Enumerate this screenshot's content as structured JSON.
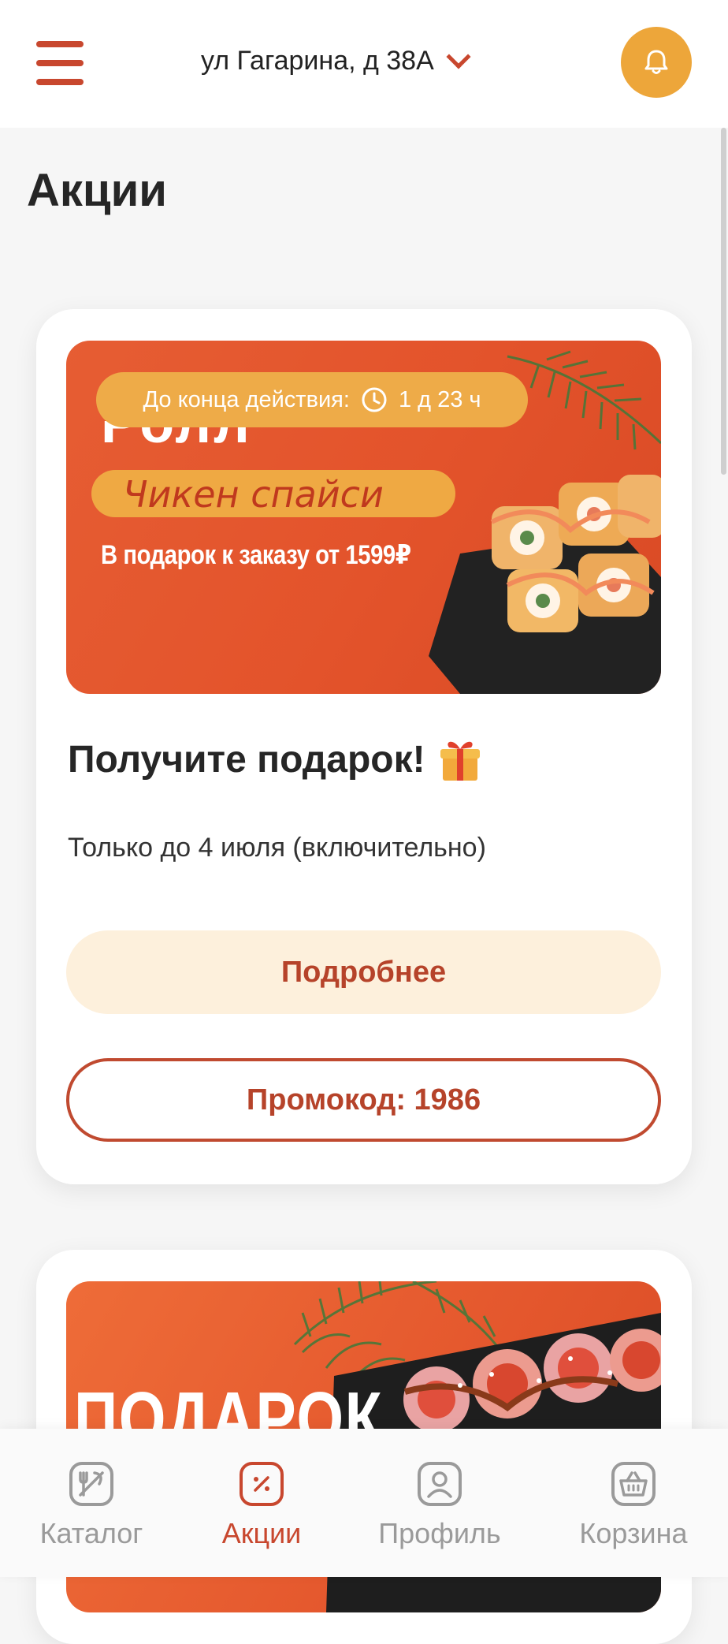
{
  "header": {
    "address": "ул Гагарина, д 38А"
  },
  "page": {
    "title": "Акции"
  },
  "promos": [
    {
      "timer_label": "До конца действия:",
      "timer_value": "1 д 23 ч",
      "banner_title": "Ролл",
      "banner_product": "Чикен спайси",
      "banner_subtitle": "В подарок к заказу от 1599₽",
      "title": "Получите подарок!",
      "subtitle": "Только до 4 июля (включительно)",
      "more_label": "Подробнее",
      "promo_label": "Промокод: 1986"
    },
    {
      "banner_title": "ПОДАРОК"
    }
  ],
  "nav": {
    "items": [
      {
        "label": "Каталог",
        "icon": "catalog-icon"
      },
      {
        "label": "Акции",
        "icon": "promo-icon",
        "active": true
      },
      {
        "label": "Профиль",
        "icon": "profile-icon"
      },
      {
        "label": "Корзина",
        "icon": "basket-icon"
      }
    ]
  },
  "colors": {
    "accent": "#c8472e",
    "bell_bg": "#eda63a",
    "banner_bg": "#e3532b",
    "more_button_bg": "#fdf0dc"
  }
}
